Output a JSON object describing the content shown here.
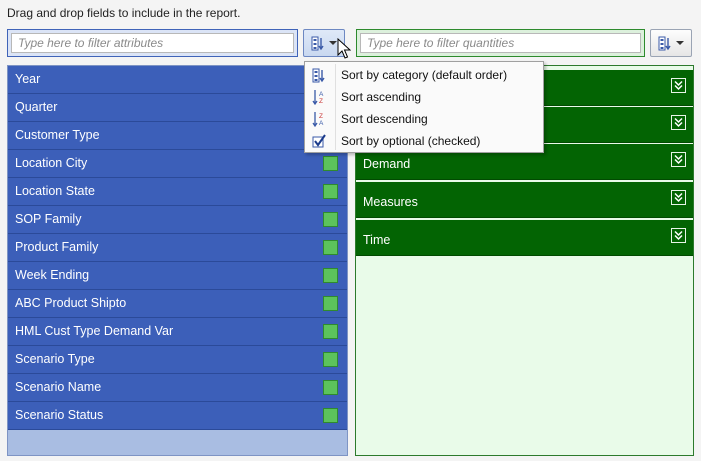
{
  "instruction": "Drag and drop fields to include in the report.",
  "attr_filter": {
    "placeholder": "Type here to filter attributes"
  },
  "qty_filter": {
    "placeholder": "Type here to filter quantities"
  },
  "attributes": [
    {
      "label": "Year",
      "checked": false
    },
    {
      "label": "Quarter",
      "checked": false
    },
    {
      "label": "Customer Type",
      "checked": false
    },
    {
      "label": "Location City",
      "checked": true
    },
    {
      "label": "Location State",
      "checked": true
    },
    {
      "label": "SOP Family",
      "checked": true
    },
    {
      "label": "Product Family",
      "checked": true
    },
    {
      "label": "Week Ending",
      "checked": true
    },
    {
      "label": "ABC Product Shipto",
      "checked": true
    },
    {
      "label": "HML Cust Type Demand Var",
      "checked": true
    },
    {
      "label": "Scenario Type",
      "checked": true
    },
    {
      "label": "Scenario Name",
      "checked": true
    },
    {
      "label": "Scenario Status",
      "checked": true
    }
  ],
  "quantities": [
    {
      "label": ""
    },
    {
      "label": ""
    },
    {
      "label": "Demand"
    },
    {
      "label": "Measures"
    },
    {
      "label": "Time"
    }
  ],
  "sort_menu": [
    {
      "label": "Sort by category (default order)",
      "icon": "category-icon"
    },
    {
      "label": "Sort ascending",
      "icon": "sort-ascending-icon"
    },
    {
      "label": "Sort descending",
      "icon": "sort-descending-icon"
    },
    {
      "label": "Sort by optional (checked)",
      "icon": "checked-icon"
    }
  ],
  "colors": {
    "attr_item": "#3c5fb9",
    "qty_item": "#036403",
    "check": "#5cc35c"
  }
}
